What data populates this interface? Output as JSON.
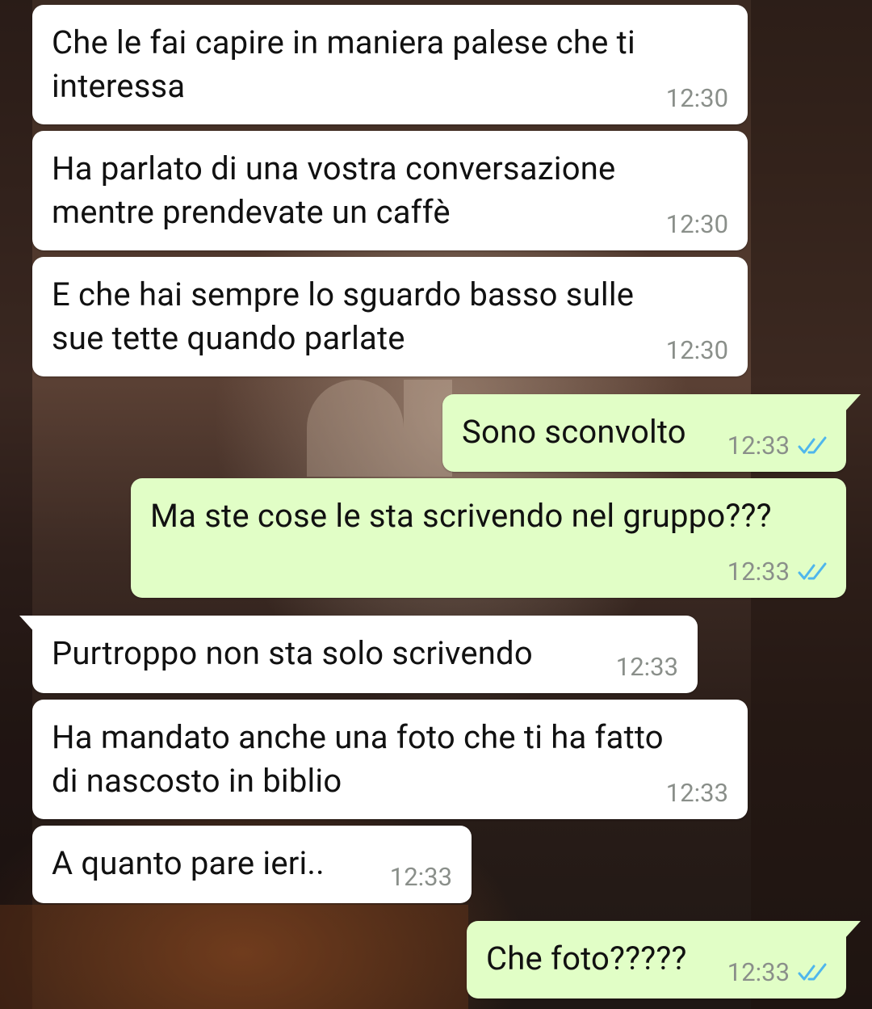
{
  "messages": [
    {
      "text": "Che le fai capire in maniera palese che ti\ninteressa",
      "time": "12:30"
    },
    {
      "text": "Ha parlato di una vostra conversazione\nmentre prendevate un caffè",
      "time": "12:30"
    },
    {
      "text": "E che hai sempre lo sguardo basso sulle\nsue tette quando parlate",
      "time": "12:30"
    },
    {
      "text": "Sono sconvolto",
      "time": "12:33",
      "status_icon": "double-check-icon"
    },
    {
      "text": "Ma ste cose le sta scrivendo nel gruppo???",
      "time": "12:33",
      "status_icon": "double-check-icon"
    },
    {
      "text": "Purtroppo non sta solo scrivendo",
      "time": "12:33"
    },
    {
      "text": "Ha mandato anche una foto che ti ha fatto\ndi nascosto in biblio",
      "time": "12:33"
    },
    {
      "text": "A quanto pare ieri..",
      "time": "12:33"
    },
    {
      "text": "Che foto?????",
      "time": "12:33",
      "status_icon": "double-check-icon"
    }
  ],
  "colors": {
    "incoming_bubble": "#ffffff",
    "outgoing_bubble": "#e1fec6",
    "timestamp": "#8a8f8a",
    "read_tick": "#4fb6ec"
  }
}
